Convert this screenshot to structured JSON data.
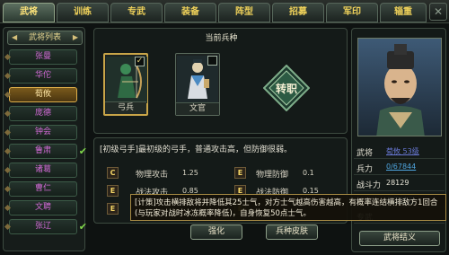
{
  "tabs": [
    {
      "label": "武将",
      "active": true
    },
    {
      "label": "训练",
      "active": false
    },
    {
      "label": "专武",
      "active": false
    },
    {
      "label": "装备",
      "active": false
    },
    {
      "label": "阵型",
      "active": false
    },
    {
      "label": "招募",
      "active": false
    },
    {
      "label": "军印",
      "active": false
    },
    {
      "label": "辎重",
      "active": false
    }
  ],
  "close_label": "✕",
  "general_list": {
    "title": "武将列表",
    "items": [
      {
        "label": "张曼",
        "color": "#d26ad6",
        "selected": false,
        "checked": false
      },
      {
        "label": "华佗",
        "color": "#d26ad6",
        "selected": false,
        "checked": false
      },
      {
        "label": "荀攸",
        "color": "#d26ad6",
        "selected": true,
        "checked": false
      },
      {
        "label": "庞德",
        "color": "#d26ad6",
        "selected": false,
        "checked": false
      },
      {
        "label": "钟会",
        "color": "#d26ad6",
        "selected": false,
        "checked": false
      },
      {
        "label": "鲁肃",
        "color": "#d26ad6",
        "selected": false,
        "checked": true
      },
      {
        "label": "诸葛",
        "color": "#d26ad6",
        "selected": false,
        "checked": false
      },
      {
        "label": "曹仁",
        "color": "#d26ad6",
        "selected": false,
        "checked": false
      },
      {
        "label": "文聘",
        "color": "#d26ad6",
        "selected": false,
        "checked": false
      },
      {
        "label": "张辽",
        "color": "#d26ad6",
        "selected": false,
        "checked": true
      }
    ]
  },
  "troop": {
    "title": "当前兵种",
    "cards": [
      {
        "label": "弓兵",
        "selected": true,
        "check": "✓"
      },
      {
        "label": "文官",
        "selected": false,
        "check": ""
      }
    ],
    "transfer_label": "转职",
    "description": "[初级弓手]最初级的弓手，普通攻击高，但防御很弱。",
    "stats": [
      {
        "icon": "C",
        "name": "物理攻击",
        "value": "1.25"
      },
      {
        "icon": "E",
        "name": "物理防御",
        "value": "0.1"
      },
      {
        "icon": "E",
        "name": "战法攻击",
        "value": "0.85"
      },
      {
        "icon": "E",
        "name": "战法防御",
        "value": "0.15"
      },
      {
        "icon": "E",
        "name": "",
        "value": ""
      },
      {
        "icon": "E",
        "name": "",
        "value": ""
      }
    ],
    "tooltip": "[计策]攻击横排敌将并降低其25士气，对方士气越高伤害越高，有概率连结横排敌方1回合(与玩家对战时冰冻概率降低)，自身恢复50点士气。",
    "buttons": {
      "strengthen": "强化",
      "skin": "兵种皮肤"
    }
  },
  "general": {
    "attributes": [
      {
        "key": "武将",
        "value": "荀攸 53级",
        "style": "link"
      },
      {
        "key": "兵力",
        "value": "0/67844",
        "style": "link2"
      },
      {
        "key": "战斗力",
        "value": "28129",
        "style": "plain"
      },
      {
        "key": "技能",
        "value": "天策抽击",
        "style": "link2"
      },
      {
        "key": "专武",
        "value": "",
        "style": "plain"
      }
    ],
    "button": "武将结义"
  },
  "colors": {
    "gold": "#f0d25a",
    "accent_border": "#c9a548",
    "name_purple": "#d26ad6"
  }
}
